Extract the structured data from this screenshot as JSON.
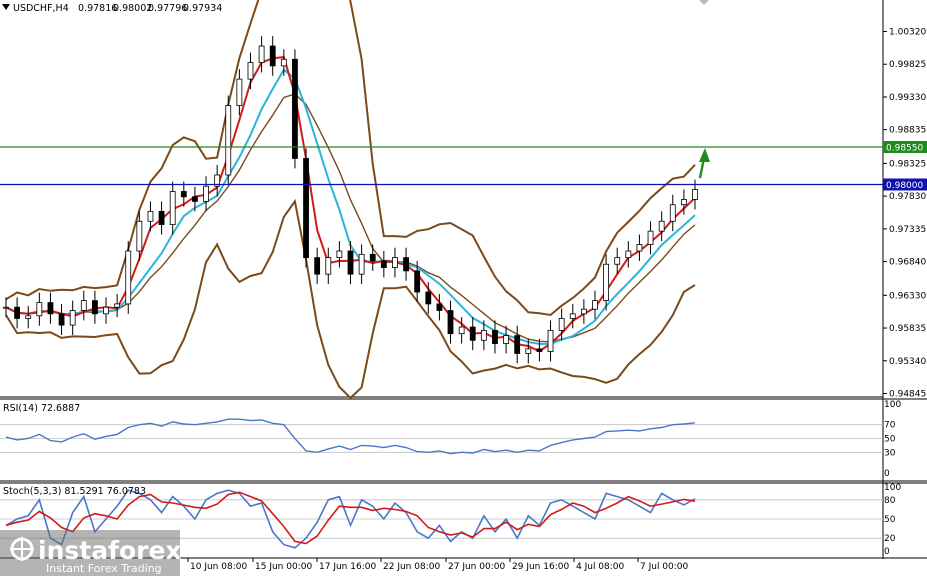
{
  "header": {
    "symbol": "USDCHF,H4",
    "open": "0.97816",
    "high": "0.98002",
    "low": "0.97796",
    "close": "0.97934"
  },
  "price_axis": {
    "ticks": [
      "1.00320",
      "0.99825",
      "0.99330",
      "0.98835",
      "0.98325",
      "0.97830",
      "0.97335",
      "0.96840",
      "0.96330",
      "0.95835",
      "0.95340",
      "0.94845"
    ]
  },
  "levels": {
    "green": {
      "label": "0.98550",
      "value": 0.9855,
      "color": "#1f8a1f"
    },
    "blue": {
      "label": "0.98000",
      "value": 0.98,
      "color": "#1010b0"
    }
  },
  "rsi": {
    "title": "RSI(14) 72.6887",
    "ticks": [
      "100",
      "70",
      "50",
      "30",
      "0"
    ],
    "last": 72.69
  },
  "stoch": {
    "title": "Stoch(5,3,3) 81.5291 76.0783",
    "ticks": [
      "100",
      "80",
      "50",
      "20",
      "0"
    ]
  },
  "time_axis": {
    "labels": [
      "10 Jun 08:00",
      "15 Jun 00:00",
      "17 Jun 16:00",
      "22 Jun 08:00",
      "27 Jun 00:00",
      "29 Jun 16:00",
      "4 Jul 08:00",
      "7 Jul 00:00"
    ]
  },
  "watermark": {
    "brand": "instaforex",
    "tagline": "Instant Forex Trading"
  },
  "chart_data": {
    "type": "line",
    "title": "USDCHF,H4",
    "series": [
      {
        "name": "Close",
        "values": [
          0.9615,
          0.9598,
          0.9602,
          0.9622,
          0.9605,
          0.9588,
          0.961,
          0.9625,
          0.9605,
          0.9615,
          0.962,
          0.97,
          0.9745,
          0.976,
          0.974,
          0.979,
          0.9782,
          0.9775,
          0.9798,
          0.9815,
          0.992,
          0.996,
          0.9985,
          1.001,
          0.998,
          0.999,
          0.984,
          0.969,
          0.9665,
          0.969,
          0.97,
          0.9665,
          0.9695,
          0.9685,
          0.9675,
          0.969,
          0.967,
          0.9638,
          0.962,
          0.961,
          0.9575,
          0.9585,
          0.9565,
          0.958,
          0.956,
          0.9572,
          0.9545,
          0.9552,
          0.9548,
          0.958,
          0.9598,
          0.9605,
          0.9612,
          0.9625,
          0.968,
          0.969,
          0.97,
          0.971,
          0.973,
          0.9745,
          0.977,
          0.9778,
          0.9793
        ]
      }
    ],
    "rsi_values": [
      52,
      48,
      50,
      56,
      47,
      45,
      52,
      57,
      49,
      53,
      56,
      66,
      70,
      72,
      68,
      74,
      71,
      70,
      72,
      74,
      78,
      78,
      76,
      77,
      72,
      70,
      50,
      32,
      30,
      35,
      39,
      34,
      40,
      39,
      37,
      40,
      37,
      31,
      30,
      32,
      28,
      30,
      29,
      34,
      31,
      33,
      30,
      33,
      32,
      40,
      44,
      48,
      50,
      52,
      60,
      61,
      62,
      61,
      64,
      66,
      70,
      71,
      72.7
    ],
    "stoch_k": [
      40,
      50,
      55,
      80,
      20,
      10,
      60,
      85,
      30,
      50,
      70,
      95,
      90,
      80,
      60,
      85,
      70,
      50,
      80,
      90,
      95,
      90,
      70,
      75,
      30,
      10,
      5,
      20,
      45,
      80,
      85,
      40,
      80,
      70,
      50,
      75,
      60,
      30,
      20,
      40,
      15,
      30,
      20,
      55,
      30,
      50,
      20,
      55,
      40,
      75,
      80,
      70,
      60,
      50,
      90,
      85,
      80,
      70,
      60,
      90,
      80,
      72,
      81.5
    ],
    "ylim": [
      0.94845,
      1.0057
    ]
  }
}
